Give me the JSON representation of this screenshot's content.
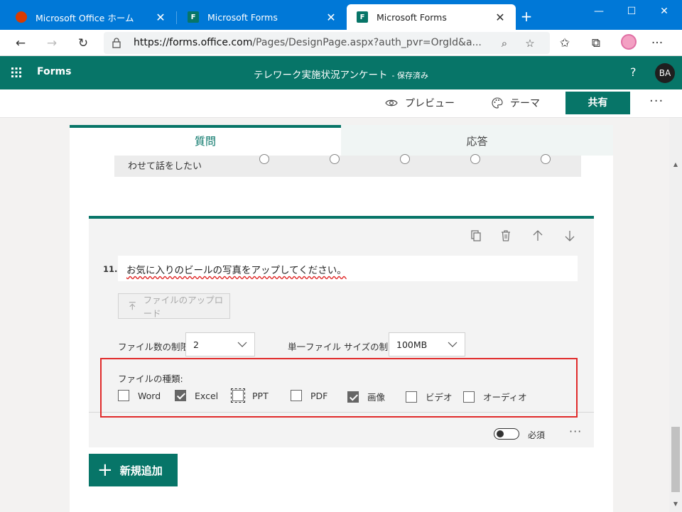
{
  "browser": {
    "tabs": [
      {
        "title": "Microsoft Office ホーム",
        "favicon": "office-icon"
      },
      {
        "title": "Microsoft Forms",
        "favicon": "forms-icon"
      },
      {
        "title": "Microsoft Forms",
        "favicon": "forms-icon"
      }
    ],
    "active_tab": 2,
    "new_tab_label": "+",
    "url_domain": "https://forms.office.com",
    "url_path": "/Pages/DesignPage.aspx?auth_pvr=OrgId&a..."
  },
  "app": {
    "brand": "Forms",
    "form_title": "テレワーク実施状況アンケート",
    "saved_status": "- 保存済み",
    "help_label": "?",
    "avatar_initials": "BA"
  },
  "toolbar": {
    "preview_label": "プレビュー",
    "theme_label": "テーマ",
    "share_label": "共有",
    "more_label": "···"
  },
  "tabs": {
    "questions": "質問",
    "responses": "応答"
  },
  "previous_question": {
    "text": "わせて話をしたい"
  },
  "question": {
    "number": "11.",
    "title": "お気に入りのビールの写真をアップしてください。",
    "upload_label": "ファイルのアップロード",
    "file_count_label": "ファイル数の制限:",
    "file_count_value": "2",
    "file_size_label": "単一ファイル サイズの制限:",
    "file_size_value": "100MB",
    "file_types_label": "ファイルの種類:",
    "file_types": [
      {
        "label": "Word",
        "checked": false
      },
      {
        "label": "Excel",
        "checked": true
      },
      {
        "label": "PPT",
        "checked": false
      },
      {
        "label": "PDF",
        "checked": false
      },
      {
        "label": "画像",
        "checked": true
      },
      {
        "label": "ビデオ",
        "checked": false
      },
      {
        "label": "オーディオ",
        "checked": false
      }
    ],
    "required_label": "必須",
    "more_label": "···"
  },
  "add_new_label": "新規追加",
  "colors": {
    "brand_green": "#077568",
    "browser_blue": "#0078d7",
    "highlight_red": "#e02a2a"
  }
}
